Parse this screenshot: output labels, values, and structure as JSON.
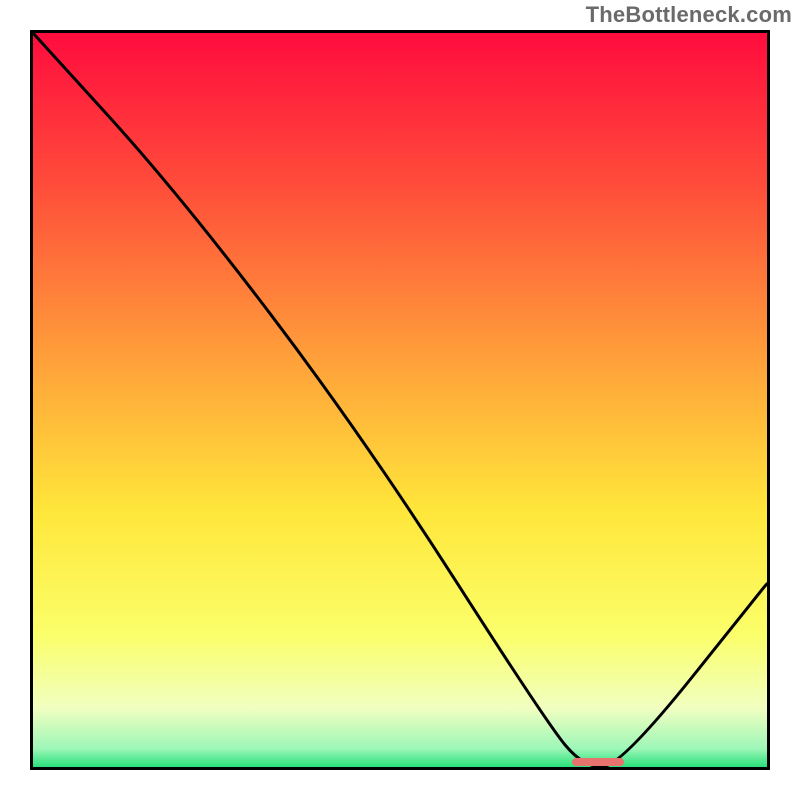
{
  "watermark": "TheBottleneck.com",
  "chart_data": {
    "type": "line",
    "title": "",
    "xlabel": "",
    "ylabel": "",
    "xlim": [
      0,
      100
    ],
    "ylim": [
      0,
      100
    ],
    "x": [
      0,
      20,
      45,
      70,
      75,
      80,
      100
    ],
    "values": [
      100,
      78,
      45,
      6,
      0,
      0,
      25
    ],
    "gradient_stops": [
      {
        "pos": 0.0,
        "color": "#ff0c3e"
      },
      {
        "pos": 0.2,
        "color": "#ff4a3a"
      },
      {
        "pos": 0.45,
        "color": "#ffa23a"
      },
      {
        "pos": 0.65,
        "color": "#ffe63a"
      },
      {
        "pos": 0.82,
        "color": "#fbff6a"
      },
      {
        "pos": 0.92,
        "color": "#f0ffc0"
      },
      {
        "pos": 0.975,
        "color": "#9df7b8"
      },
      {
        "pos": 1.0,
        "color": "#29e07a"
      }
    ],
    "marker": {
      "x": 77,
      "y": 0.7,
      "w": 7,
      "h": 1.1,
      "color": "#e7736f"
    }
  }
}
